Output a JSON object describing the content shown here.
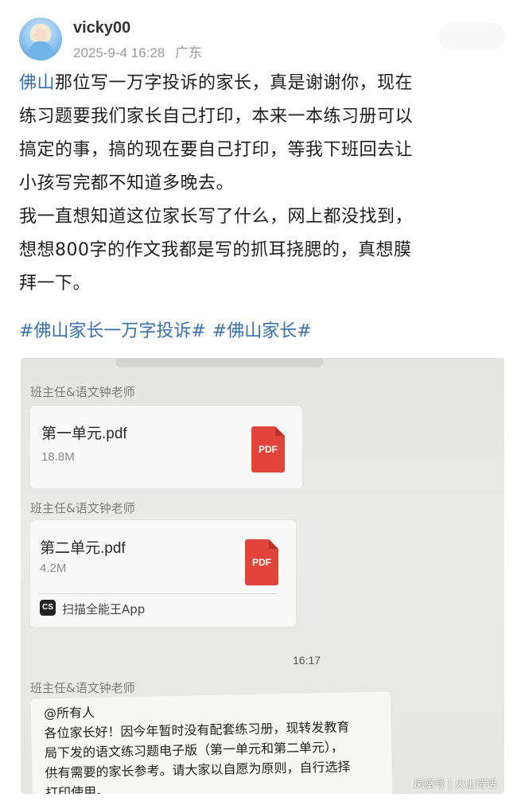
{
  "post": {
    "author": "vicky00",
    "timestamp": "2025-9-4 16:28",
    "location": "广东",
    "body_lines": [
      [
        "佛山",
        "那位写一万字投诉的家长，真是谢谢你，现在"
      ],
      [
        "",
        "练习题要我们家长自己打印，本来一本练习册可以"
      ],
      [
        "",
        "搞定的事，搞的现在要自己打印，等我下班回去让"
      ],
      [
        "",
        "小孩写完都不知道多晚去。"
      ],
      [
        "",
        "我一直想知道这位家长写了什么，网上都没找到，"
      ],
      [
        "",
        "想想800字的作文我都是写的抓耳挠腮的，真想膜"
      ],
      [
        "",
        "拜一下。"
      ]
    ],
    "hashtags": [
      "#佛山家长一万字投诉#",
      "#佛山家长#"
    ]
  },
  "photo": {
    "chat": {
      "sender_1": "班主任&语文钟老师",
      "file_1_name": "第一单元.pdf",
      "file_1_size": "18.8M",
      "pdf_label_1": "PDF",
      "sender_2": "班主任&语文钟老师",
      "file_2_name": "第二单元.pdf",
      "file_2_size": "4.2M",
      "pdf_label_2": "PDF",
      "cs_logo": "CS",
      "app_name": "扫描全能王App",
      "time": "16:17",
      "sender_3": "班主任&语文钟老师",
      "notice_lines": [
        "@所有人",
        "各位家长好！因今年暂时没有配套练习册，现转发教育",
        "局下发的语文练习题电子版（第一单元和第二单元），",
        "供有需要的家长参考。请大家以自愿为原则，自行选择",
        "打印使用。"
      ]
    },
    "watermark": "凤凰号 | 火山诗话"
  },
  "icons": {
    "avatar": "avatar-icon",
    "pdf": "pdf-icon",
    "camscanner": "camscanner-icon"
  },
  "colors": {
    "link": "#3a6ea5",
    "pdf_red": "#e0443a",
    "meta_gray": "#9a9a9a"
  }
}
